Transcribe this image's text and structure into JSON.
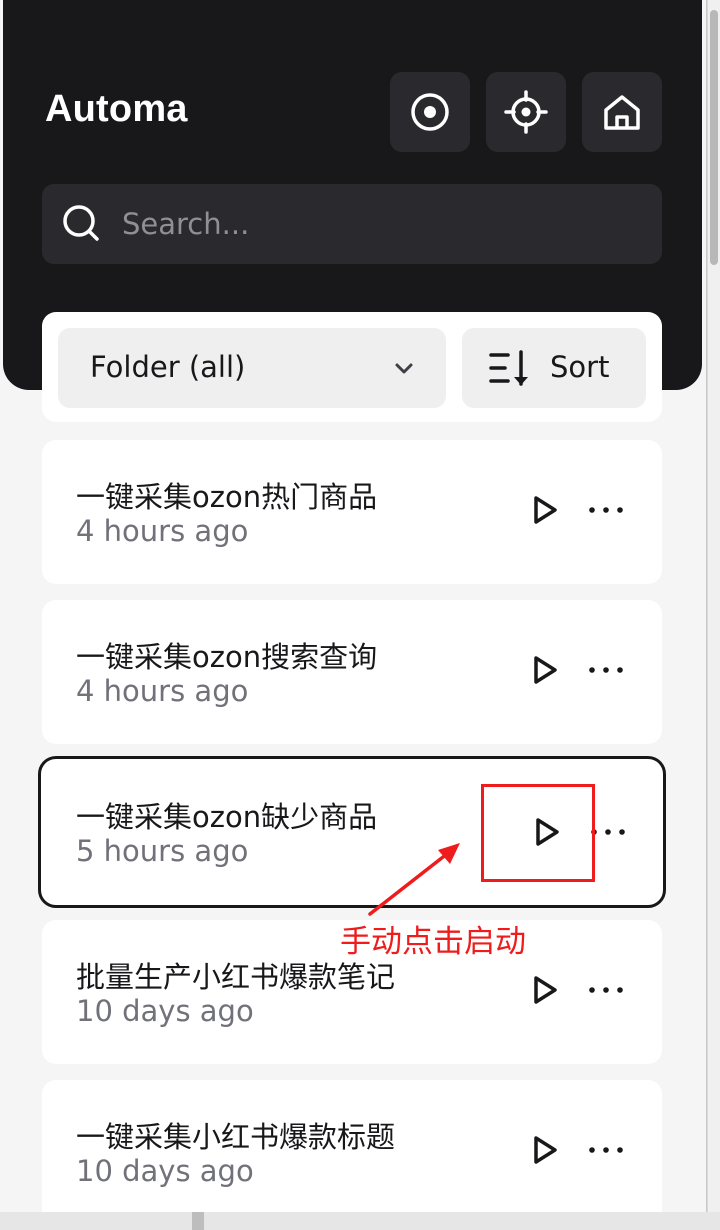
{
  "app": {
    "title": "Automa"
  },
  "header": {
    "buttons": [
      {
        "name": "record-button",
        "icon": "record-icon"
      },
      {
        "name": "element-selector-button",
        "icon": "crosshair-icon"
      },
      {
        "name": "dashboard-home-button",
        "icon": "home-icon"
      }
    ]
  },
  "search": {
    "placeholder": "Search...",
    "value": ""
  },
  "filters": {
    "folder_label": "Folder (all)",
    "sort_label": "Sort"
  },
  "workflows": [
    {
      "name": "一键采集ozon热门商品",
      "time": "4 hours ago"
    },
    {
      "name": "一键采集ozon搜索查询",
      "time": "4 hours ago"
    },
    {
      "name": "一键采集ozon缺少商品",
      "time": "5 hours ago",
      "active": true
    },
    {
      "name": "批量生产小红书爆款笔记",
      "time": "10 days ago"
    },
    {
      "name": "一键采集小红书爆款标题",
      "time": "10 days ago"
    }
  ],
  "annotation": {
    "text": "手动点击启动",
    "color": "#ee1c1c"
  },
  "colors": {
    "header_bg": "#18181b",
    "accent": "#ee1c1c",
    "muted": "#71717a"
  }
}
